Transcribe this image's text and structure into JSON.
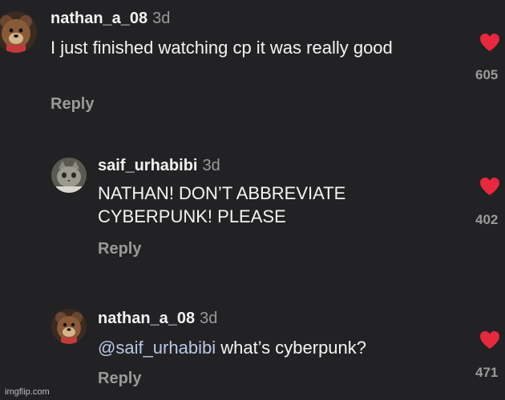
{
  "comments": [
    {
      "username": "nathan_a_08",
      "time": "3d",
      "text": "I just finished watching cp it was really good",
      "reply_label": "Reply",
      "likes": "605"
    },
    {
      "username": "saif_urhabibi",
      "time": "3d",
      "text": "NATHAN! DON’T ABBREVIATE CYBERPUNK! PLEASE",
      "reply_label": "Reply",
      "likes": "402"
    },
    {
      "username": "nathan_a_08",
      "time": "3d",
      "mention": "@saif_urhabibi",
      "text": " what’s cyberpunk?",
      "reply_label": "Reply",
      "likes": "471"
    }
  ],
  "watermark": "imgflip.com",
  "colors": {
    "background": "#222224",
    "heart": "#e8283c",
    "mention": "#b9c9e6",
    "muted": "#9a9a9a"
  },
  "icons": {
    "like": "heart-icon",
    "avatar_1": "teddy-bear-avatar",
    "avatar_2": "cat-avatar"
  }
}
